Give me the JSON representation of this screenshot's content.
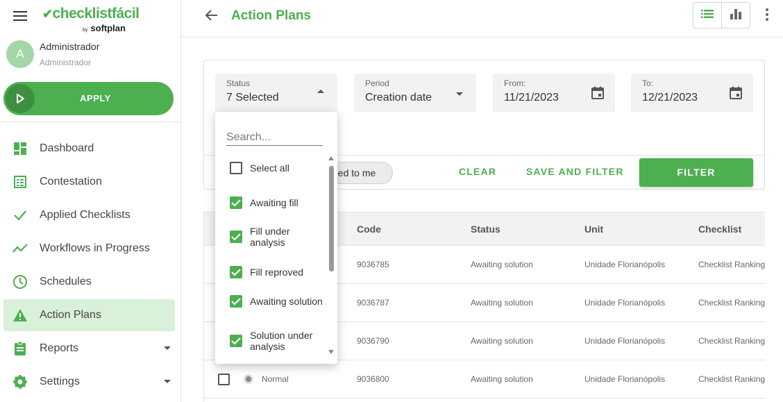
{
  "app": {
    "brand": "checklistfácil",
    "brand_by": "by",
    "brand_company": "softplan",
    "colors": {
      "primary": "#4caf50",
      "active_bg": "#d9f0d9"
    }
  },
  "user": {
    "initial": "A",
    "name": "Administrador",
    "role": "Administrador"
  },
  "apply_button": {
    "label": "APPLY"
  },
  "sidebar": {
    "items": [
      {
        "label": "Dashboard",
        "icon": "dashboard-icon"
      },
      {
        "label": "Contestation",
        "icon": "contestation-icon"
      },
      {
        "label": "Applied Checklists",
        "icon": "check-icon"
      },
      {
        "label": "Workflows in Progress",
        "icon": "trend-icon"
      },
      {
        "label": "Schedules",
        "icon": "clock-icon"
      },
      {
        "label": "Action Plans",
        "icon": "warning-icon",
        "active": true
      },
      {
        "label": "Reports",
        "icon": "clipboard-icon",
        "expandable": true
      },
      {
        "label": "Settings",
        "icon": "gear-icon",
        "expandable": true
      }
    ]
  },
  "header": {
    "title": "Action Plans"
  },
  "filters": {
    "status": {
      "label": "Status",
      "value": "7 Selected"
    },
    "period": {
      "label": "Period",
      "value": "Creation date"
    },
    "from": {
      "label": "From:",
      "value": "11/21/2023"
    },
    "to": {
      "label": "To:",
      "value": "12/21/2023"
    },
    "chip": "ned to me",
    "clear": "CLEAR",
    "save_filter": "SAVE AND FILTER",
    "filter": "FILTER"
  },
  "dropdown": {
    "search_placeholder": "Search...",
    "options": [
      {
        "label": "Select all",
        "checked": false
      },
      {
        "label": "Awaiting fill",
        "checked": true
      },
      {
        "label": "Fill under analysis",
        "checked": true
      },
      {
        "label": "Fill reproved",
        "checked": true
      },
      {
        "label": "Awaiting solution",
        "checked": true
      },
      {
        "label": "Solution under analysis",
        "checked": true
      }
    ]
  },
  "table": {
    "columns": [
      "Code",
      "Status",
      "Unit",
      "Checklist"
    ],
    "rows": [
      {
        "priority": "",
        "code": "9036785",
        "status": "Awaiting solution",
        "unit": "Unidade Florianópolis",
        "checklist": "Checklist Ranking"
      },
      {
        "priority": "",
        "code": "9036787",
        "status": "Awaiting solution",
        "unit": "Unidade Florianópolis",
        "checklist": "Checklist Ranking"
      },
      {
        "priority": "",
        "code": "9036790",
        "status": "Awaiting solution",
        "unit": "Unidade Florianópolis",
        "checklist": "Checklist Ranking"
      },
      {
        "priority": "Normal",
        "code": "9036800",
        "status": "Awaiting solution",
        "unit": "Unidade Florianópolis",
        "checklist": "Checklist Ranking"
      }
    ]
  }
}
